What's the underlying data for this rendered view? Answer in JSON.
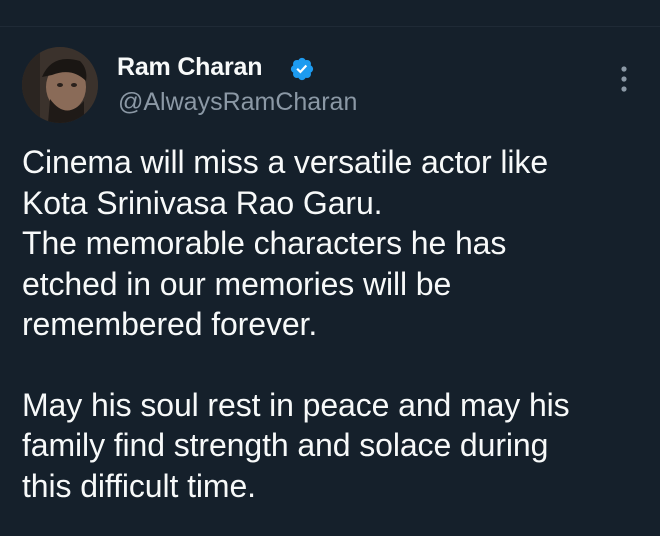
{
  "author": {
    "name": "Ram Charan",
    "handle": "@AlwaysRamCharan",
    "verified_color": "#1d9bf0"
  },
  "icons": {
    "verified": "verified-badge-icon",
    "more": "more-options-icon"
  },
  "tweet": {
    "paragraph1_lines": [
      "Cinema will miss a versatile actor like",
      "Kota Srinivasa Rao Garu.",
      "The memorable characters he has",
      "etched in our memories will be",
      "remembered forever."
    ],
    "paragraph2_lines": [
      "May his soul rest in peace and may his",
      "family find strength and solace during",
      "this difficult time."
    ]
  },
  "theme": {
    "background": "#15202b",
    "text": "#f7f9f9",
    "secondary_text": "#8b98a5"
  }
}
